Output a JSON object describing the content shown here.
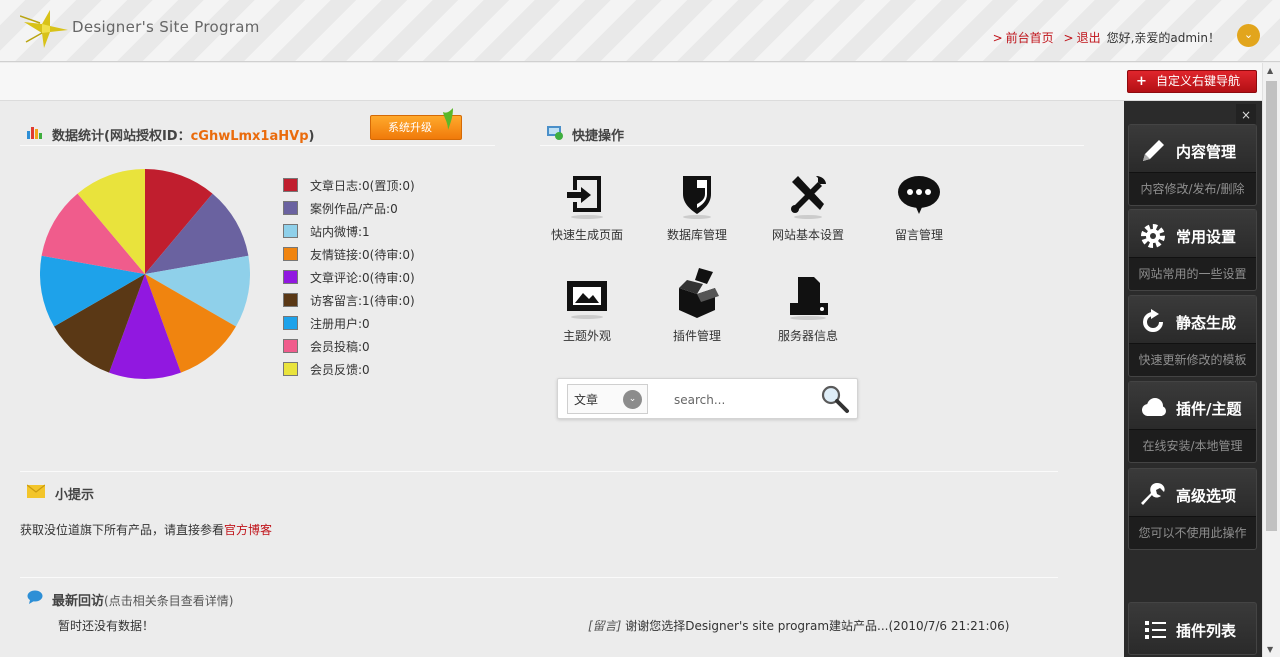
{
  "header": {
    "logo_text": "Designer's Site Program",
    "frontpage_link": "前台首页",
    "logout_link": "退出",
    "greeting": "您好,亲爱的admin！",
    "link_prefix": ">"
  },
  "custom_nav_button": "自定义右键导航",
  "stats": {
    "title_prefix": "数据统计(网站授权ID：",
    "license_id": "cGhwLmx1aHVp",
    "title_suffix": ")",
    "upgrade_button": "系统升级",
    "legend": [
      {
        "label": "文章日志:0(置顶:0)",
        "color": "#c01e2e"
      },
      {
        "label": "案例作品/产品:0",
        "color": "#6a62a0"
      },
      {
        "label": "站内微博:1",
        "color": "#8fd0ea"
      },
      {
        "label": "友情链接:0(待审:0)",
        "color": "#f0840f"
      },
      {
        "label": "文章评论:0(待审:0)",
        "color": "#9118e0"
      },
      {
        "label": "访客留言:1(待审:0)",
        "color": "#5a3815"
      },
      {
        "label": "注册用户:0",
        "color": "#1ea2ea"
      },
      {
        "label": "会员投稿:0",
        "color": "#f05c8c"
      },
      {
        "label": "会员反馈:0",
        "color": "#e9e33c"
      }
    ]
  },
  "quick": {
    "title": "快捷操作",
    "ops": [
      {
        "label": "快速生成页面"
      },
      {
        "label": "数据库管理"
      },
      {
        "label": "网站基本设置"
      },
      {
        "label": "留言管理"
      },
      {
        "label": "主题外观"
      },
      {
        "label": "插件管理"
      },
      {
        "label": "服务器信息"
      }
    ],
    "search": {
      "select_value": "文章",
      "placeholder": "search..."
    }
  },
  "tips": {
    "title": "小提示",
    "text": "获取没位道旗下所有产品，请直接参看",
    "link": "官方博客"
  },
  "visits": {
    "title": "最新回访",
    "subtitle": "(点击相关条目查看详情)",
    "empty": "暂时还没有数据！",
    "msg_tag": "[留言]",
    "msg_text": "谢谢您选择Designer's site program建站产品...(2010/7/6 21:21:06)"
  },
  "sidebar": {
    "close": "×",
    "cards": [
      {
        "title": "内容管理",
        "desc": "内容修改/发布/删除",
        "icon": "pencil-icon"
      },
      {
        "title": "常用设置",
        "desc": "网站常用的一些设置",
        "icon": "gear-icon"
      },
      {
        "title": "静态生成",
        "desc": "快速更新修改的模板",
        "icon": "refresh-icon"
      },
      {
        "title": "插件/主题",
        "desc": "在线安装/本地管理",
        "icon": "cloud-icon"
      },
      {
        "title": "高级选项",
        "desc": "您可以不使用此操作",
        "icon": "wrench-icon"
      }
    ],
    "plugin_list": "插件列表"
  }
}
